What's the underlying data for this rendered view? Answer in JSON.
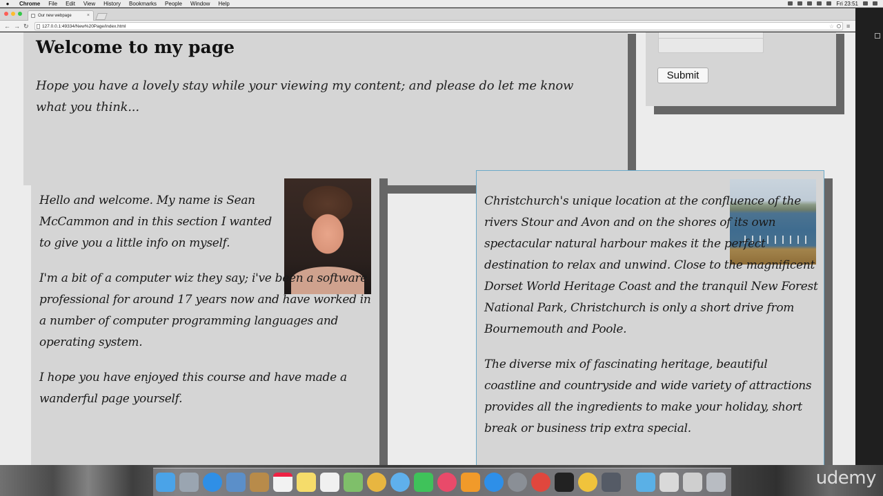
{
  "menubar": {
    "app_name": "Chrome",
    "items": [
      "File",
      "Edit",
      "View",
      "History",
      "Bookmarks",
      "People",
      "Window",
      "Help"
    ],
    "clock": "Fri 23:51"
  },
  "browser": {
    "tab_title": "Our new webpage",
    "tab_close": "×",
    "url": "127.0.0.1:49334/New%20Page/index.html",
    "back_glyph": "←",
    "forward_glyph": "→",
    "reload_glyph": "↻",
    "star_glyph": "☆",
    "menu_glyph": "≡"
  },
  "page": {
    "heading": "Welcome to my page",
    "intro": "Hope you have a lovely stay while your viewing my content; and please do let me know what you think...",
    "form": {
      "submit_label": "Submit"
    },
    "about": {
      "paragraphs": [
        "Hello and welcome. My name is Sean McCammon and in this section I wanted to give you a little info on myself.",
        "I'm a bit of a computer wiz they say; i've been a software professional for around 17 years now and have worked in a number of computer programming languages and operating system.",
        "I hope you have enjoyed this course and have made a wanderful page yourself."
      ]
    },
    "christchurch": {
      "paragraphs": [
        "Christchurch's unique location at the confluence of the rivers Stour and Avon and on the shores of its own spectacular natural harbour makes it the perfect destination to relax and unwind. Close to the magnificent Dorset World Heritage Coast and the tranquil New Forest National Park, Christchurch is only a short drive from Bournemouth and Poole.",
        "The diverse mix of fascinating heritage, beautiful coastline and countryside and wide variety of attractions provides all the ingredients to make your holiday, short break or business trip extra special."
      ]
    }
  },
  "watermark": "udemy",
  "dock_icons": [
    "finder-icon",
    "launchpad-icon",
    "safari-icon",
    "preview-icon",
    "contacts-icon",
    "calendar-icon",
    "notes-icon",
    "reminders-icon",
    "maps-icon",
    "photos-icon",
    "messages-icon",
    "facetime-icon",
    "itunes-icon",
    "ibooks-icon",
    "app-store-icon",
    "system-preferences-icon",
    "chrome-icon",
    "terminal-icon",
    "chrome-canary-icon",
    "screen-recorder-icon",
    "downloads-folder-icon",
    "documents-icon",
    "preview-file-icon",
    "trash-icon"
  ],
  "dock_colors": [
    "#4aa3e8",
    "#9aa5b1",
    "#2f8fe6",
    "#5b8fc9",
    "#b88b4a",
    "#f2f2f2",
    "#f5dc6a",
    "#f0f0f0",
    "#7fbf6a",
    "#e8b640",
    "#5fb0ec",
    "#3fc25a",
    "#e94a6a",
    "#f19a2a",
    "#2e8fe8",
    "#8a8f96",
    "#e0473d",
    "#222222",
    "#f0c33c",
    "#555b66",
    "#5ab0e6",
    "#d9d9d9",
    "#cfcfcf",
    "#b8bcc2"
  ]
}
